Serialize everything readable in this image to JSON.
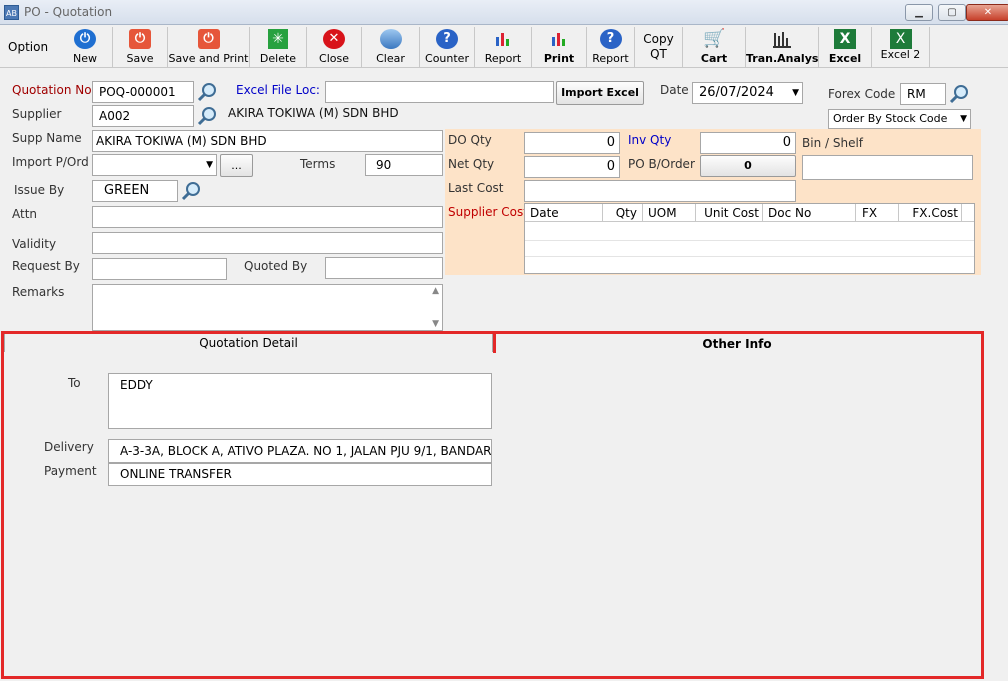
{
  "window": {
    "app_icon": "AB",
    "title": "PO - Quotation"
  },
  "toolbar": {
    "option_label": "Option",
    "buttons": [
      {
        "label": "New",
        "icon": "power-icon"
      },
      {
        "label": "Save",
        "icon": "save-icon"
      },
      {
        "label": "Save and Print",
        "icon": "save-print-icon"
      },
      {
        "label": "Delete",
        "icon": "delete-icon"
      },
      {
        "label": "Close",
        "icon": "close-icon"
      },
      {
        "label": "Clear",
        "icon": "clear-icon"
      },
      {
        "label": "Counter",
        "icon": "help-icon"
      },
      {
        "label": "Report",
        "icon": "report-chart-icon"
      },
      {
        "label": "Print",
        "icon": "print-chart-icon"
      },
      {
        "label": "Report",
        "icon": "help-icon"
      },
      {
        "label": "Copy QT",
        "icon": ""
      },
      {
        "label": "Cart",
        "icon": "cart-icon"
      },
      {
        "label": "Tran.Analys",
        "icon": "analysis-icon"
      },
      {
        "label": "Excel",
        "icon": "excel-icon"
      },
      {
        "label": "Excel 2",
        "icon": "excel-icon"
      }
    ]
  },
  "form": {
    "quotation_no_label": "Quotation No",
    "quotation_no": "POQ-000001",
    "excel_file_loc_label": "Excel File Loc:",
    "excel_file_loc": "",
    "import_excel": "Import Excel",
    "date_label": "Date",
    "date": "26/07/2024",
    "forex_code_label": "Forex Code",
    "forex_code": "RM",
    "order_by": "Order By Stock Code",
    "supplier_label": "Supplier",
    "supplier": "A002",
    "supplier_name_display": "AKIRA TOKIWA (M) SDN BHD",
    "supp_name_label": "Supp Name",
    "supp_name": "AKIRA TOKIWA (M) SDN BHD",
    "import_pord_label": "Import P/Ord",
    "import_pord": "",
    "ellipsis": "...",
    "terms_label": "Terms",
    "terms": "90",
    "issue_by_label": "Issue By",
    "issue_by": "GREEN",
    "attn_label": "Attn",
    "attn": "",
    "validity_label": "Validity",
    "validity": "",
    "request_by_label": "Request By",
    "request_by": "",
    "quoted_by_label": "Quoted By",
    "quoted_by": "",
    "remarks_label": "Remarks",
    "remarks": ""
  },
  "stock_panel": {
    "do_qty_label": "DO Qty",
    "do_qty": "0",
    "inv_qty_label": "Inv Qty",
    "inv_qty": "0",
    "bin_shelf_label": "Bin / Shelf",
    "bin_shelf": "",
    "net_qty_label": "Net Qty",
    "net_qty": "0",
    "po_border_label": "PO B/Order",
    "po_border": "0",
    "last_cost_label": "Last Cost",
    "last_cost": "",
    "supplier_cost_label": "Supplier Cost",
    "cost_columns": [
      "Date",
      "Qty",
      "UOM",
      "Unit Cost",
      "Doc No",
      "FX",
      "FX.Cost"
    ]
  },
  "tabs": [
    {
      "label": "Quotation Detail",
      "active": false
    },
    {
      "label": "Other Info",
      "active": true
    }
  ],
  "other_info": {
    "to_label": "To",
    "to": "EDDY",
    "delivery_label": "Delivery",
    "delivery": "A-3-3A, BLOCK A, ATIVO PLAZA. NO 1, JALAN PJU 9/1, BANDAR",
    "payment_label": "Payment",
    "payment": "ONLINE TRANSFER"
  },
  "colors": {
    "highlight_border": "#e32828",
    "panel": "#fde3c8"
  }
}
